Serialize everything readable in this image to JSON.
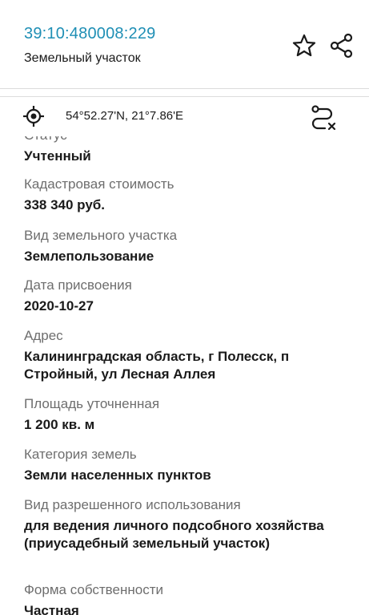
{
  "header": {
    "cadastral_number": "39:10:480008:229",
    "object_type": "Земельный участок",
    "favorite_icon": "star-outline-icon",
    "share_icon": "share-icon"
  },
  "location": {
    "icon": "crosshair-location-icon",
    "coordinates": "54°52.27'N, 21°7.86'E",
    "route_icon": "route-clear-icon"
  },
  "fields": [
    {
      "label": "Статус",
      "value": "Учтенный"
    },
    {
      "label": "Кадастровая стоимость",
      "value": "338 340 руб."
    },
    {
      "label": "Вид земельного участка",
      "value": "Землепользование"
    },
    {
      "label": "Дата присвоения",
      "value": "2020-10-27"
    },
    {
      "label": "Адрес",
      "value": "Калининградская область, г Полесск, п Стройный, ул Лесная Аллея"
    },
    {
      "label": "Площадь уточненная",
      "value": "1 200 кв. м"
    },
    {
      "label": "Категория земель",
      "value": "Земли населенных пунктов"
    },
    {
      "label": "Вид разрешенного использования",
      "value": "для ведения личного подсобного хозяйства (приусадебный земельный участок)"
    },
    {
      "label": "Форма собственности",
      "value": "Частная"
    }
  ]
}
